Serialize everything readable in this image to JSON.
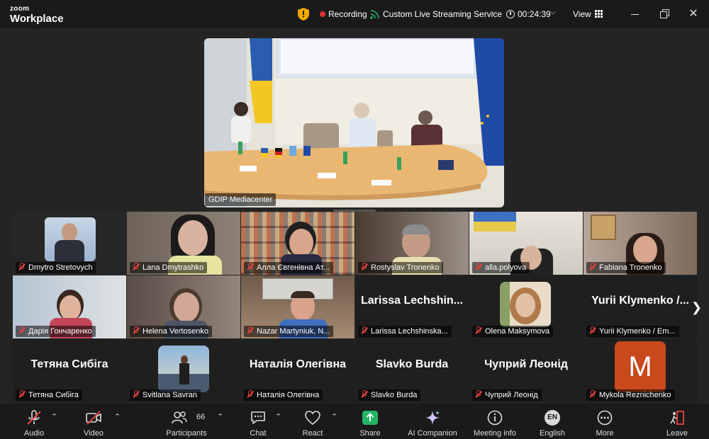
{
  "app": {
    "brand_top": "zoom",
    "brand_bottom": "Workplace"
  },
  "header": {
    "recording_label": "Recording",
    "streaming_label": "Custom Live Streaming Service",
    "timer": "00:24:39",
    "view_label": "View"
  },
  "main_video": {
    "participant_name": "GDIP Mediacenter"
  },
  "gallery": {
    "tiles": [
      {
        "name": "Dmytro Stretovych",
        "muted": true
      },
      {
        "name": "Lana Dmytrashko",
        "muted": true
      },
      {
        "name": "Алла Євгенівна Ат...",
        "muted": true
      },
      {
        "name": "Rostyslav Tronenko",
        "muted": true
      },
      {
        "name": "alla.polyova",
        "muted": true
      },
      {
        "name": "Fabiana Tronenko",
        "muted": true
      },
      {
        "name": "Дарія Гончаренко",
        "muted": true
      },
      {
        "name": "Helena Vertosenko",
        "muted": true
      },
      {
        "name": "Nazar Martyniuk, N...",
        "muted": true
      },
      {
        "name": "Larissa Lechshinska...",
        "display": "Larissa  Lechshin...",
        "muted": true
      },
      {
        "name": "Olena Maksymova",
        "muted": true
      },
      {
        "name": "Yurii Klymenko / Em...",
        "display": "Yurii Klymenko /...",
        "muted": true
      },
      {
        "name": "Тетяна Сибіга",
        "display": "Тетяна Сибіга",
        "muted": true
      },
      {
        "name": "Svitlana Savran",
        "muted": true
      },
      {
        "name": "Наталія Олегівна",
        "display": "Наталія Олегівна",
        "muted": true
      },
      {
        "name": "Slavko Burda",
        "display": "Slavko Burda",
        "muted": true
      },
      {
        "name": "Чуприй Леонід",
        "display": "Чуприй Леонід",
        "muted": true
      },
      {
        "name": "Mykola Reznichenko",
        "avatar_letter": "M",
        "muted": true
      }
    ]
  },
  "toolbar": {
    "audio": "Audio",
    "video": "Video",
    "participants": "Participants",
    "participants_count": "66",
    "chat": "Chat",
    "react": "React",
    "share": "Share",
    "ai_companion": "AI Companion",
    "meeting_info": "Meeting info",
    "language_badge": "EN",
    "language": "English",
    "more": "More",
    "leave": "Leave"
  },
  "colors": {
    "background": "#242424",
    "recording_red": "#e0322f",
    "share_green": "#23b466",
    "mute_red": "#e4433f",
    "avatar_orange": "#c9491c"
  }
}
